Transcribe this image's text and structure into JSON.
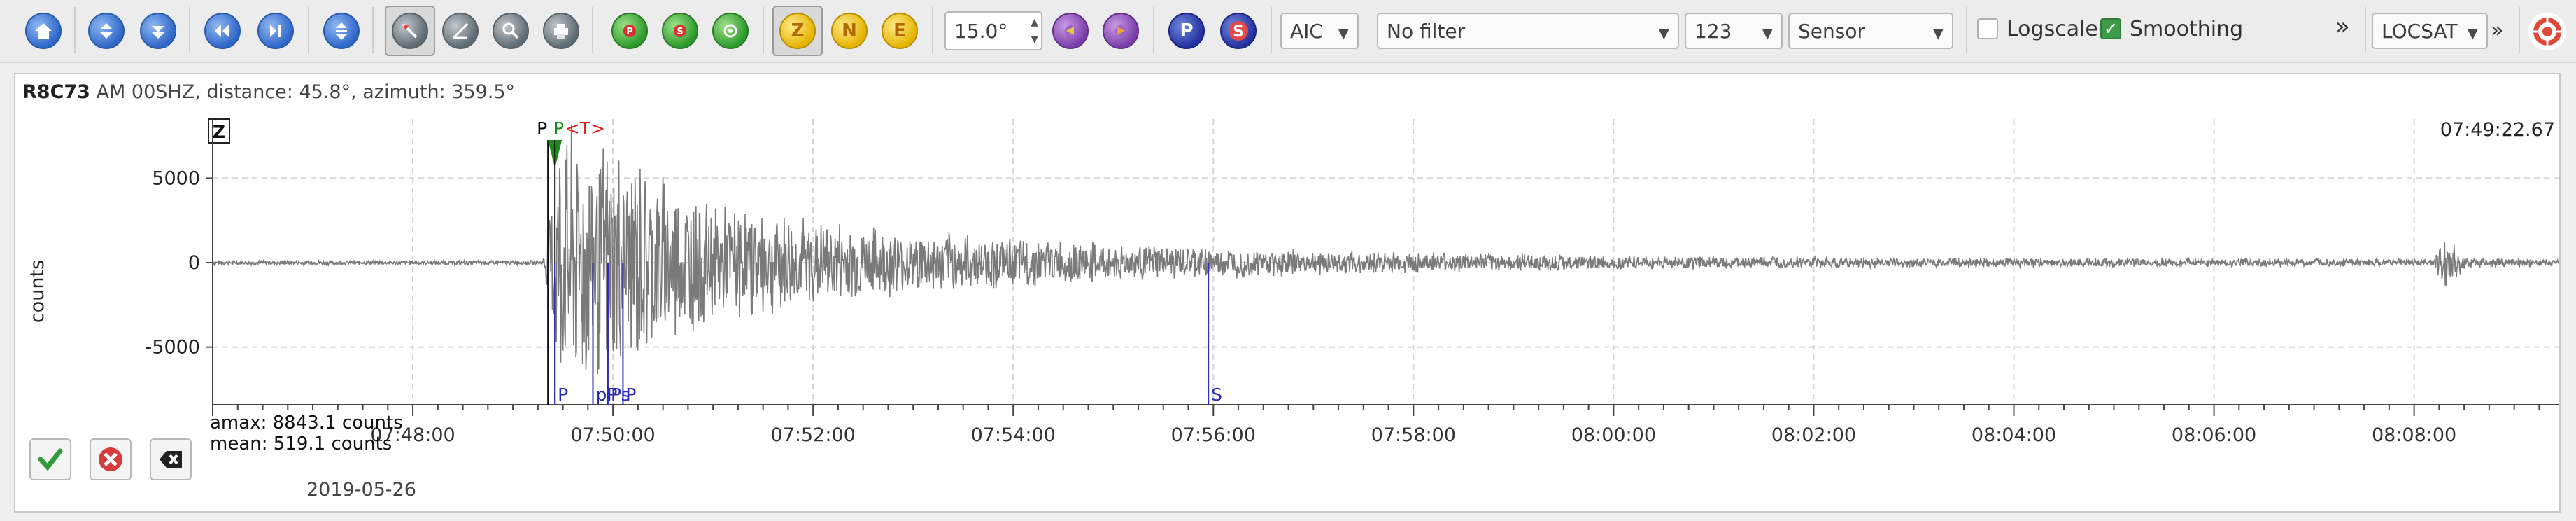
{
  "toolbar": {
    "phase_p_label": "P",
    "phase_s_label": "S",
    "comp_z_label": "Z",
    "comp_n_label": "N",
    "comp_e_label": "E",
    "angle_value": "15.0°",
    "picker_method": "AIC",
    "filter_value": "No filter",
    "channel_value": "123",
    "unit_value": "Sensor",
    "logscale_label": "Logscale",
    "smoothing_label": "Smoothing",
    "overflow_glyph": "»",
    "locator_value": "LOCSAT",
    "icons": [
      "home-icon",
      "scroll-up-icon",
      "scroll-down-icon",
      "scroll-left-icon",
      "scroll-right-icon",
      "align-icon",
      "pick-tool-icon",
      "measure-icon",
      "zoom-tool-icon",
      "print-icon",
      "filter-p-icon",
      "filter-s-icon",
      "filter-search-icon",
      "p-marker-icon",
      "s-marker-icon",
      "target-icon"
    ]
  },
  "trace": {
    "station": "R8C73",
    "description": "AM  00SHZ, distance: 45.8°, azimuth: 359.5°",
    "component": "Z",
    "time_label": "07:49:22.67",
    "ylabel": "counts",
    "amax": "amax: 8843.1 counts",
    "mean": "mean: 519.1 counts",
    "date": "2019-05-26"
  },
  "chart_data": {
    "type": "line",
    "ylabel": "counts",
    "ylim": [
      -8000,
      8500
    ],
    "yticks": [
      5000,
      0,
      -5000
    ],
    "ytick_labels": [
      "5000",
      "0",
      "-5000"
    ],
    "xticks_labels": [
      "07:48:00",
      "07:50:00",
      "07:52:00",
      "07:54:00",
      "07:56:00",
      "07:58:00",
      "08:00:00",
      "08:02:00",
      "08:04:00",
      "08:06:00",
      "08:08:00"
    ],
    "xtick_minutes": [
      48,
      50,
      52,
      54,
      56,
      58,
      60,
      62,
      64,
      66,
      68
    ],
    "xlim_minutes": [
      46.0,
      69.45
    ],
    "picks_top": [
      {
        "label": "P",
        "minute": 49.35,
        "color": "#000000"
      },
      {
        "label": "P",
        "minute": 49.42,
        "color": "#1d8a1d"
      },
      {
        "label": "<T>",
        "minute": 49.55,
        "color": "#e02020"
      }
    ],
    "theoretical_phases": [
      {
        "label": "P",
        "minute": 49.42
      },
      {
        "label": "pP",
        "minute": 49.8
      },
      {
        "label": "Ps",
        "minute": 49.95
      },
      {
        "label": "P",
        "minute": 50.1
      },
      {
        "label": "S",
        "minute": 55.95
      }
    ],
    "envelope": [
      {
        "minute": 46.0,
        "amp": 150
      },
      {
        "minute": 49.3,
        "amp": 150
      },
      {
        "minute": 49.45,
        "amp": 8843
      },
      {
        "minute": 50.2,
        "amp": 7200
      },
      {
        "minute": 51.0,
        "amp": 3800
      },
      {
        "minute": 53.0,
        "amp": 2000
      },
      {
        "minute": 55.0,
        "amp": 1200
      },
      {
        "minute": 57.0,
        "amp": 800
      },
      {
        "minute": 60.0,
        "amp": 450
      },
      {
        "minute": 64.0,
        "amp": 300
      },
      {
        "minute": 68.2,
        "amp": 250
      },
      {
        "minute": 68.3,
        "amp": 2200
      },
      {
        "minute": 68.5,
        "amp": 400
      },
      {
        "minute": 69.45,
        "amp": 200
      }
    ]
  },
  "actions": {
    "accept": "accept-icon",
    "reject": "reject-icon",
    "clear": "clear-icon"
  }
}
